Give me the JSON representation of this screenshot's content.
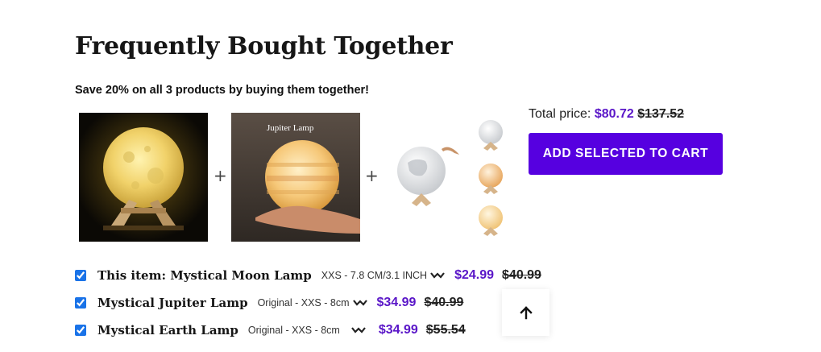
{
  "section": {
    "title": "Frequently Bought Together",
    "subtitle": "Save 20% on all 3 products by buying them together!"
  },
  "images": [
    {
      "alt": "Mystical Moon Lamp photo"
    },
    {
      "alt": "Mystical Jupiter Lamp photo",
      "overlay_text": "Jupiter Lamp"
    },
    {
      "alt": "Mystical Earth Lamp photo"
    }
  ],
  "separators": {
    "plus": "+"
  },
  "total": {
    "label": "Total price:",
    "sale": "$80.72",
    "original": "$137.52"
  },
  "cart_button": {
    "label": "ADD SELECTED TO CART"
  },
  "items": [
    {
      "checked": true,
      "name": "This item: Mystical Moon Lamp",
      "variant": "XXS - 7.8 CM/3.1 INCH",
      "sale": "$24.99",
      "original": "$40.99"
    },
    {
      "checked": true,
      "name": "Mystical Jupiter Lamp",
      "variant": "Original - XXS - 8cm",
      "sale": "$34.99",
      "original": "$40.99"
    },
    {
      "checked": true,
      "name": "Mystical Earth Lamp",
      "variant": "Original - XXS - 8cm",
      "sale": "$34.99",
      "original": "$55.54"
    }
  ],
  "icons": {
    "dropdown": "chevron-down-icon",
    "back_to_top": "arrow-up-icon"
  },
  "colors": {
    "accent": "#5600e0",
    "sale_price": "#5a16c8",
    "checkbox": "#1a73e8"
  }
}
